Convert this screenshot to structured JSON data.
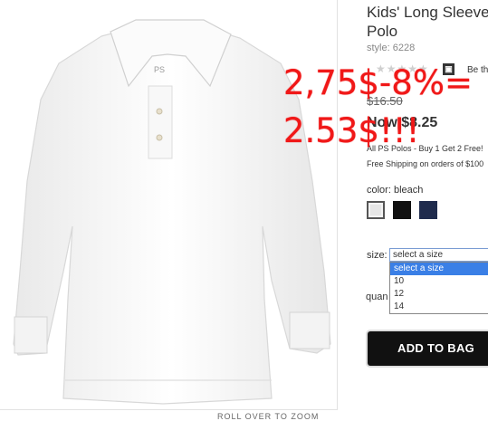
{
  "product": {
    "title_line1": "Kids' Long Sleeve",
    "title_line2": "Polo",
    "style": "style: 6228",
    "stars": "★★★★★",
    "review_icon": "▣",
    "review_link": "Be th",
    "original_price": "$16.50",
    "current_price": "Now $8.25",
    "promo": "All PS Polos - Buy 1 Get 2 Free!",
    "shipping": "Free Shipping on orders of $100",
    "color_label": "color:",
    "color_value": "bleach",
    "colors": [
      "#e6e6e6",
      "#111111",
      "#1f2b4d"
    ],
    "size_label": "size:",
    "size_selected": "select a size",
    "size_options": [
      "select a size",
      "10",
      "12",
      "14"
    ],
    "qty_label": "quan",
    "add_to_bag": "ADD TO BAG",
    "image_logo": "PS",
    "zoom_hint": "ROLL OVER TO ZOOM"
  },
  "annotation": {
    "line1": "2,75$-8%=",
    "line2": "2.53$!!!",
    "color": "#f01818"
  }
}
